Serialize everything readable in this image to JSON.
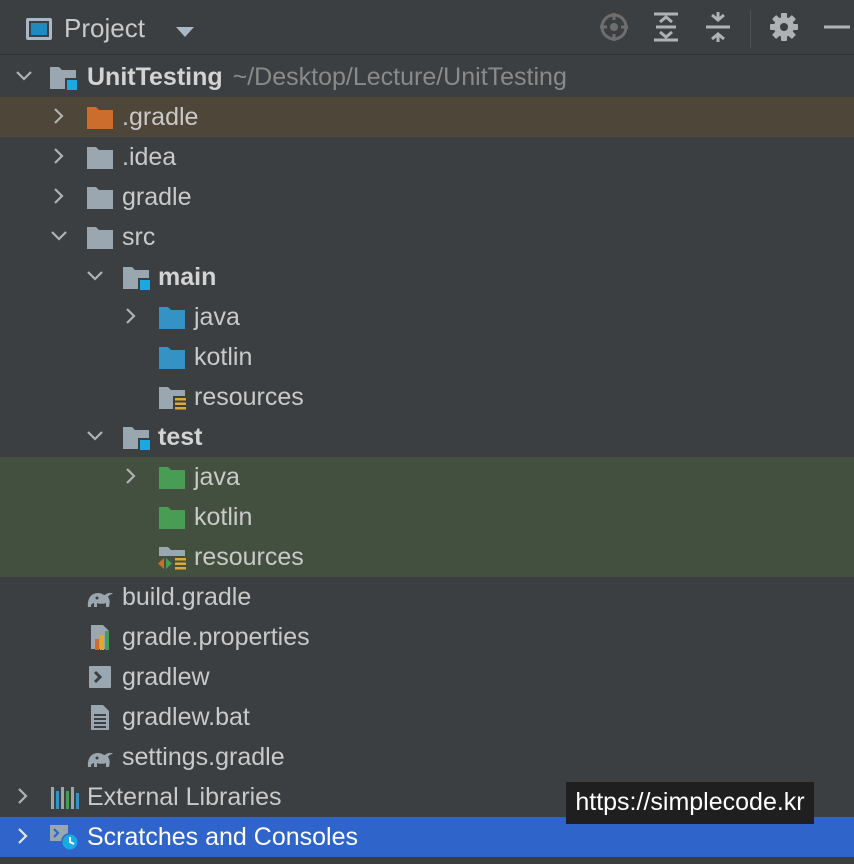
{
  "header": {
    "title": "Project"
  },
  "tree": [
    {
      "label": "UnitTesting",
      "path": "~/Desktop/Lecture/UnitTesting",
      "icon": "module-folder-icon",
      "chevron": "down"
    },
    {
      "label": ".gradle",
      "icon": "folder-orange-icon",
      "chevron": "right"
    },
    {
      "label": ".idea",
      "icon": "folder-icon",
      "chevron": "right"
    },
    {
      "label": "gradle",
      "icon": "folder-icon",
      "chevron": "right"
    },
    {
      "label": "src",
      "icon": "folder-icon",
      "chevron": "down"
    },
    {
      "label": "main",
      "icon": "module-folder-icon",
      "chevron": "down"
    },
    {
      "label": "java",
      "icon": "source-folder-icon",
      "chevron": "right"
    },
    {
      "label": "kotlin",
      "icon": "source-folder-icon"
    },
    {
      "label": "resources",
      "icon": "resources-folder-icon"
    },
    {
      "label": "test",
      "icon": "module-folder-icon",
      "chevron": "down"
    },
    {
      "label": "java",
      "icon": "test-folder-icon",
      "chevron": "right"
    },
    {
      "label": "kotlin",
      "icon": "test-folder-icon"
    },
    {
      "label": "resources",
      "icon": "test-resources-folder-icon"
    },
    {
      "label": "build.gradle",
      "icon": "gradle-elephant-icon"
    },
    {
      "label": "gradle.properties",
      "icon": "properties-file-icon"
    },
    {
      "label": "gradlew",
      "icon": "shell-script-icon"
    },
    {
      "label": "gradlew.bat",
      "icon": "text-file-icon"
    },
    {
      "label": "settings.gradle",
      "icon": "gradle-elephant-icon"
    },
    {
      "label": "External Libraries",
      "icon": "libraries-icon",
      "chevron": "right"
    },
    {
      "label": "Scratches and Consoles",
      "icon": "scratches-icon",
      "chevron": "right"
    }
  ],
  "watermark": "https://simplecode.kr",
  "colors": {
    "background": "#3c3f41",
    "selection_orange": "#4e4638",
    "selection_green": "#44503f",
    "selection_blue": "#2f65ca",
    "source_folder": "#3592c4",
    "test_folder": "#499c54",
    "excluded_folder": "#cc6d2e"
  }
}
